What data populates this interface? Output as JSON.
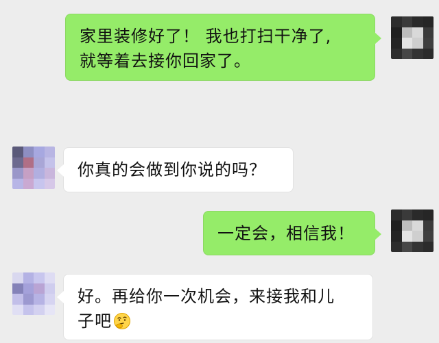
{
  "messages": [
    {
      "direction": "out",
      "lines": [
        "家里装修好了！ 我也打扫干净了,",
        "就等着去接你回家了。"
      ]
    },
    {
      "direction": "in",
      "lines": [
        "你真的会做到你说的吗？"
      ]
    },
    {
      "direction": "out",
      "lines": [
        "一定会，相信我！"
      ]
    },
    {
      "direction": "in",
      "lines": [
        "好。再给你一次机会，来接我和儿",
        "子吧"
      ]
    }
  ],
  "emoji_icon": "thinking-face-emoji-icon",
  "colors": {
    "background": "#ededed",
    "outgoing_bubble": "#95ec69",
    "incoming_bubble": "#ffffff"
  }
}
